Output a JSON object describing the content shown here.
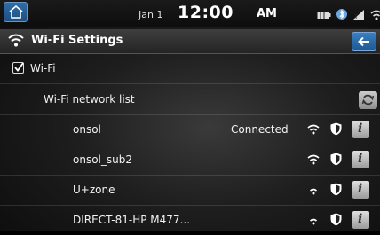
{
  "status_bar": {
    "date": "Jan 1",
    "time": "12:00",
    "ampm": "AM",
    "icons": [
      "battery-icon",
      "bluetooth-icon",
      "cellular-signal-icon",
      "wifi-status-icon"
    ]
  },
  "header": {
    "title": "Wi-Fi Settings",
    "back_icon": "back-arrow-icon"
  },
  "wifi_toggle": {
    "label": "Wi-Fi",
    "checked": true
  },
  "network_list": {
    "heading": "Wi-Fi network list",
    "networks": [
      {
        "name": "onsol",
        "status": "Connected",
        "signal": "full",
        "secured": true
      },
      {
        "name": "onsol_sub2",
        "status": "",
        "signal": "full",
        "secured": true
      },
      {
        "name": "U+zone",
        "status": "",
        "signal": "low",
        "secured": true
      },
      {
        "name": "DIRECT-81-HP M477...",
        "status": "",
        "signal": "low",
        "secured": true
      }
    ]
  },
  "colors": {
    "accent_blue": "#2e6da8",
    "background": "#1e1e1e"
  }
}
